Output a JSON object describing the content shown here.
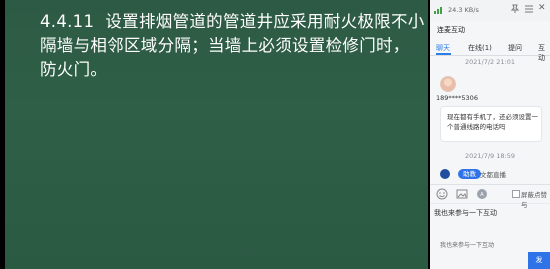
{
  "slide": {
    "text": "4.4.11  设置排烟管道的管道井应采用耐火极限不小\n隔墙与相邻区域分隔；当墙上必须设置检修门时，\n防火门。"
  },
  "panel": {
    "speed": "24.3 KB/s",
    "title": "连麦互动",
    "tabs": [
      "聊天",
      "在线(1)",
      "提问",
      "互动"
    ],
    "timestamp1": "2021/7/2 21:01",
    "user_id": "189****5306",
    "message": "现在都有手机了，还必须设置一个普通线路的电话吗",
    "timestamp2": "2021/7/9 18:59",
    "assistant_badge": "助教",
    "assistant_name": "文都直播",
    "checkbox_label": "屏蔽点赞与",
    "input_text": "我也来参与一下互动",
    "draft_hint": "我也来参与一下互动",
    "send_label": "发"
  },
  "colors": {
    "slide_bg": "#2f5f47",
    "accent": "#2f73e8",
    "panel_bg": "#f4f6f8"
  }
}
